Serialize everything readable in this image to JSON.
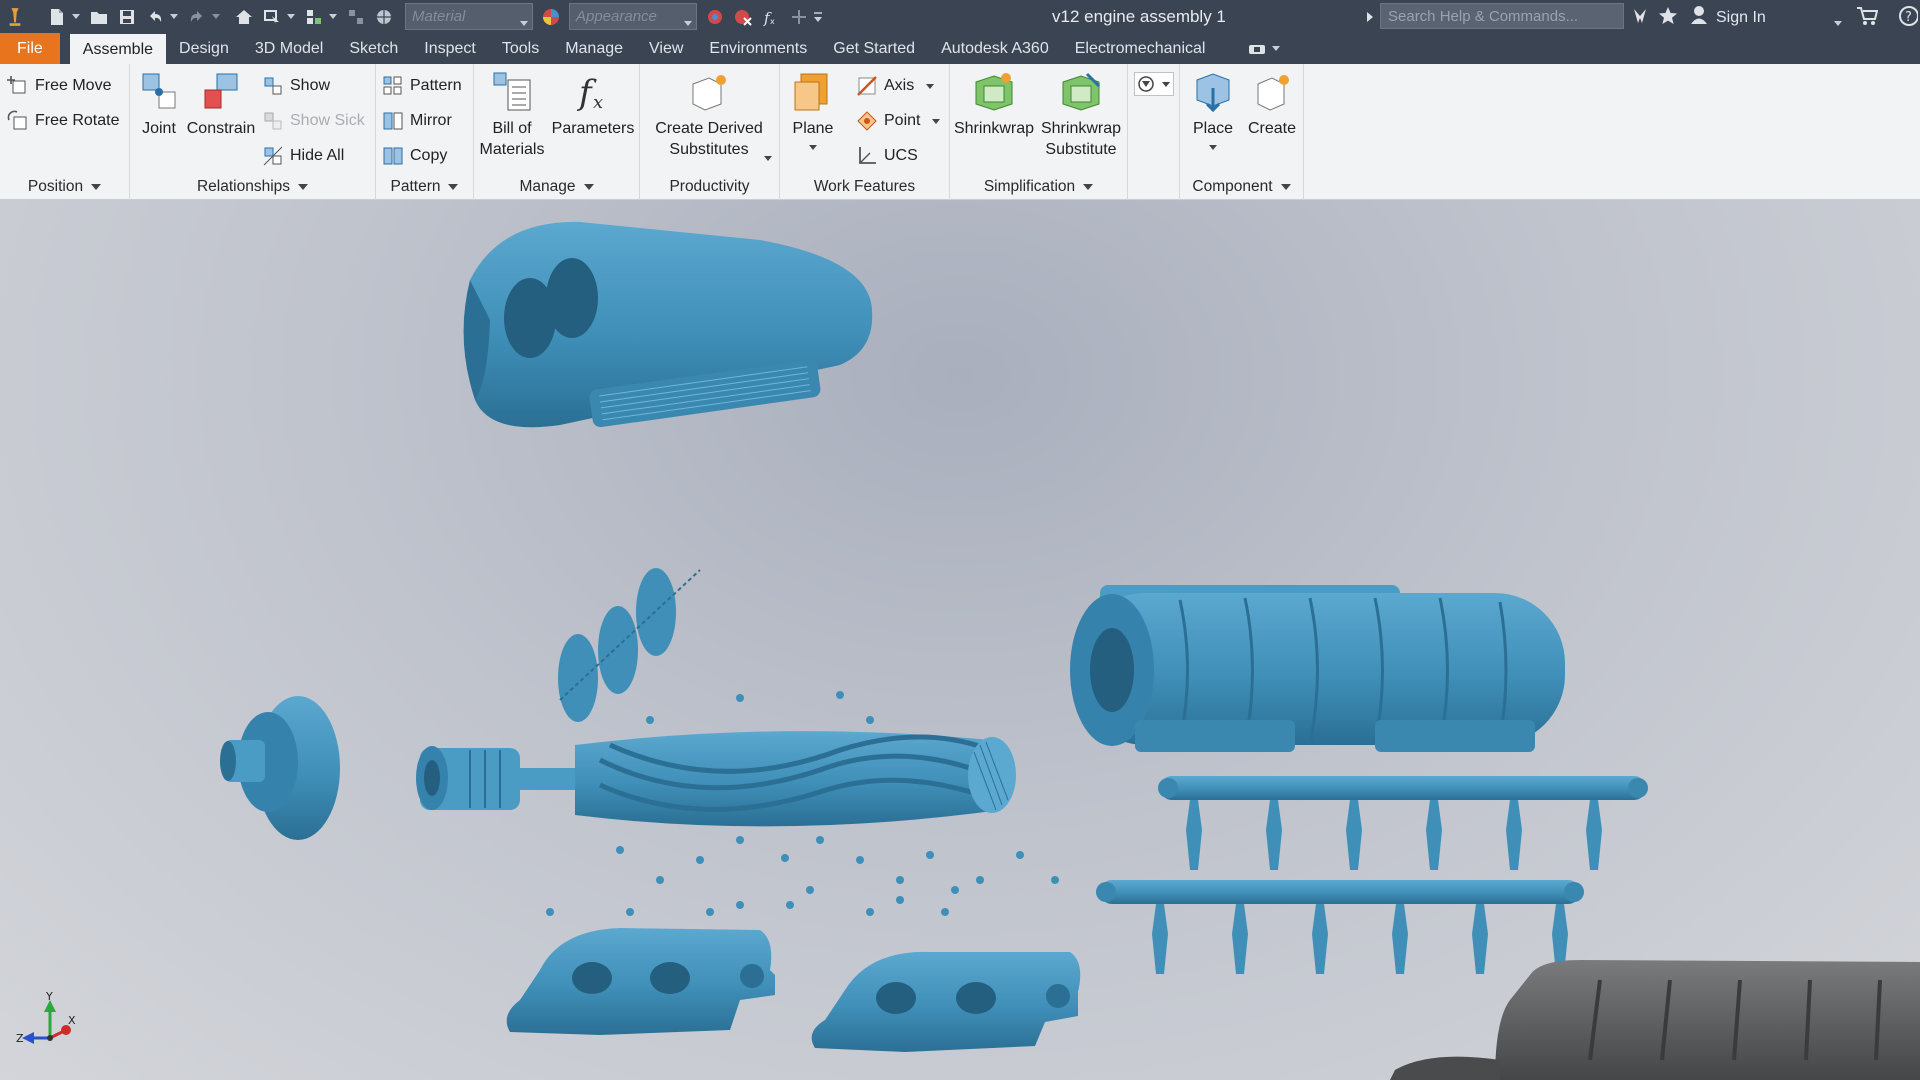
{
  "titlebar": {
    "material_placeholder": "Material",
    "appearance_placeholder": "Appearance",
    "document_title": "v12 engine assembly 1",
    "search_placeholder": "Search Help & Commands...",
    "signin_label": "Sign In"
  },
  "menu": {
    "tabs": [
      {
        "label": "File"
      },
      {
        "label": "Assemble"
      },
      {
        "label": "Design"
      },
      {
        "label": "3D Model"
      },
      {
        "label": "Sketch"
      },
      {
        "label": "Inspect"
      },
      {
        "label": "Tools"
      },
      {
        "label": "Manage"
      },
      {
        "label": "View"
      },
      {
        "label": "Environments"
      },
      {
        "label": "Get Started"
      },
      {
        "label": "Autodesk A360"
      },
      {
        "label": "Electromechanical"
      }
    ],
    "active_tab": "Assemble"
  },
  "ribbon": {
    "position": {
      "free_move": "Free Move",
      "free_rotate": "Free Rotate",
      "label": "Position"
    },
    "relationships": {
      "joint": "Joint",
      "constrain": "Constrain",
      "show": "Show",
      "show_sick": "Show Sick",
      "hide_all": "Hide All",
      "label": "Relationships"
    },
    "pattern": {
      "pattern": "Pattern",
      "mirror": "Mirror",
      "copy": "Copy",
      "label": "Pattern"
    },
    "manage": {
      "bom_line1": "Bill of",
      "bom_line2": "Materials",
      "parameters": "Parameters",
      "label": "Manage"
    },
    "productivity": {
      "line1": "Create Derived",
      "line2": "Substitutes",
      "label": "Productivity"
    },
    "work_features": {
      "plane": "Plane",
      "axis": "Axis",
      "point": "Point",
      "ucs": "UCS",
      "label": "Work Features"
    },
    "simplification": {
      "shrinkwrap": "Shrinkwrap",
      "shrinkwrap_sub_line1": "Shrinkwrap",
      "shrinkwrap_sub_line2": "Substitute",
      "label": "Simplification"
    },
    "component": {
      "place": "Place",
      "create": "Create",
      "label": "Component"
    }
  },
  "viewport": {
    "part_color": "#3f8fb8",
    "part_shadow": "#2b6f94",
    "block_color": "#5a5b5c",
    "triad": {
      "x": "X",
      "y": "Y",
      "z": "Z"
    }
  },
  "colors": {
    "titlebar_bg": "#3b4453",
    "file_tab": "#e8741e",
    "ribbon_bg": "#f2f3f5"
  }
}
